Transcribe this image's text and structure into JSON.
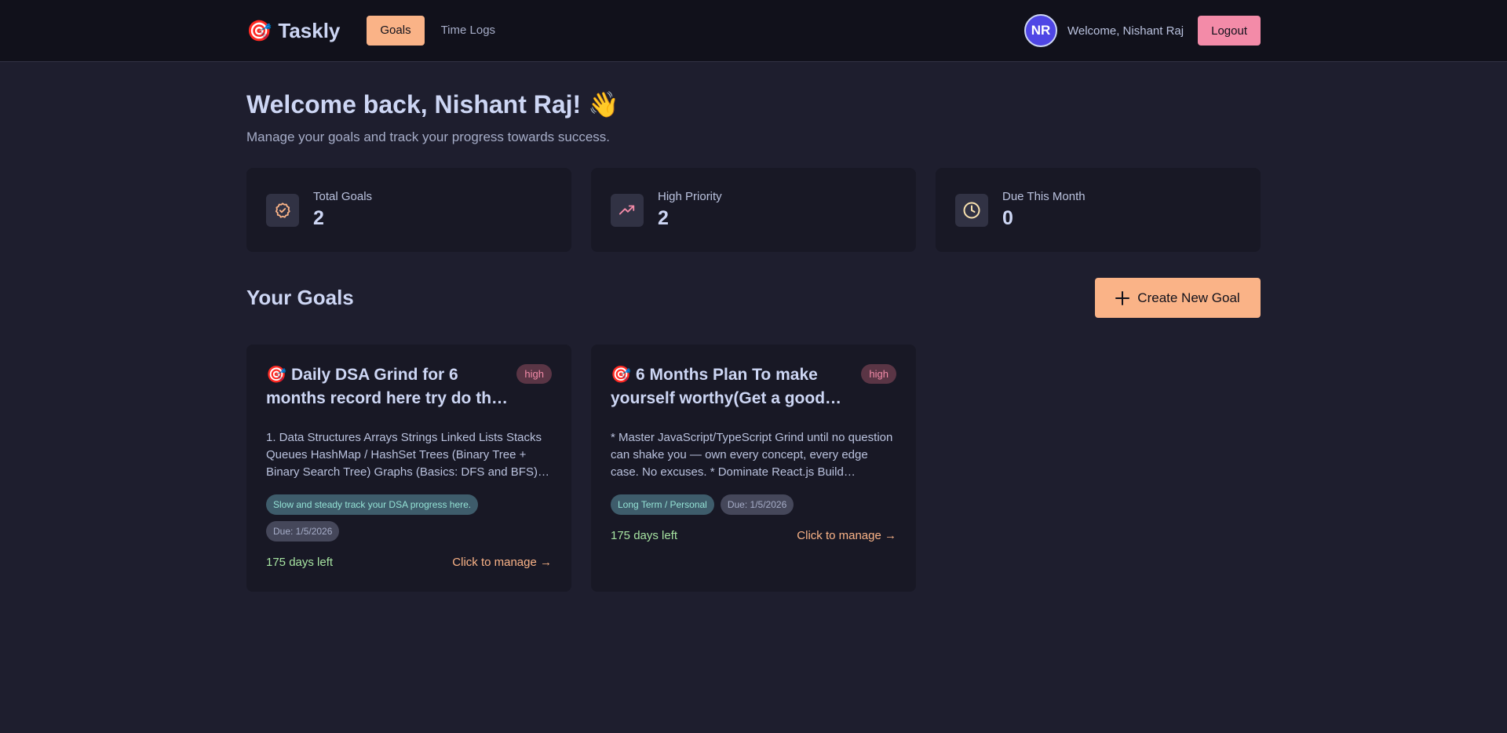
{
  "nav": {
    "brand_icon": "🎯",
    "brand": "Taskly",
    "tabs": [
      {
        "label": "Goals",
        "active": true
      },
      {
        "label": "Time Logs",
        "active": false
      }
    ],
    "avatar_initials": "NR",
    "welcome": "Welcome, Nishant Raj",
    "logout": "Logout"
  },
  "header": {
    "title": "Welcome back, Nishant Raj! 👋",
    "subtitle": "Manage your goals and track your progress towards success."
  },
  "stats": [
    {
      "label": "Total Goals",
      "value": "2",
      "icon": "check-badge-icon",
      "color": "#fab387"
    },
    {
      "label": "High Priority",
      "value": "2",
      "icon": "trending-up-icon",
      "color": "#f38ba8"
    },
    {
      "label": "Due This Month",
      "value": "0",
      "icon": "clock-icon",
      "color": "#f9e2af"
    }
  ],
  "goals_section": {
    "title": "Your Goals",
    "create_button": "Create New Goal",
    "create_icon": "plus-icon"
  },
  "goals": [
    {
      "title": "🎯 Daily DSA Grind for 6 months record here try do th…",
      "priority": "high",
      "description": "1. Data Structures Arrays Strings Linked Lists Stacks Queues HashMap / HashSet Trees (Binary Tree + Binary Search Tree) Graphs (Basics: DFS and BFS) …",
      "category": "Slow and steady track your DSA progress here.",
      "due": "Due: 1/5/2026",
      "days_left": "175 days left",
      "manage": "Click to manage →"
    },
    {
      "title": "🎯 6 Months Plan To make yourself worthy(Get a good…",
      "priority": "high",
      "description": "* Master JavaScript/TypeScript Grind until no question can shake you — own every concept, every edge case. No excuses. * Dominate React.js Build custom…",
      "category": "Long Term / Personal",
      "due": "Due: 1/5/2026",
      "days_left": "175 days left",
      "manage": "Click to manage →"
    }
  ],
  "colors": {
    "background": "#1e1e2e",
    "navbar": "#11111b",
    "card": "#181825",
    "accent": "#fab387",
    "logout": "#f38ba8",
    "success": "#a6e3a1"
  }
}
